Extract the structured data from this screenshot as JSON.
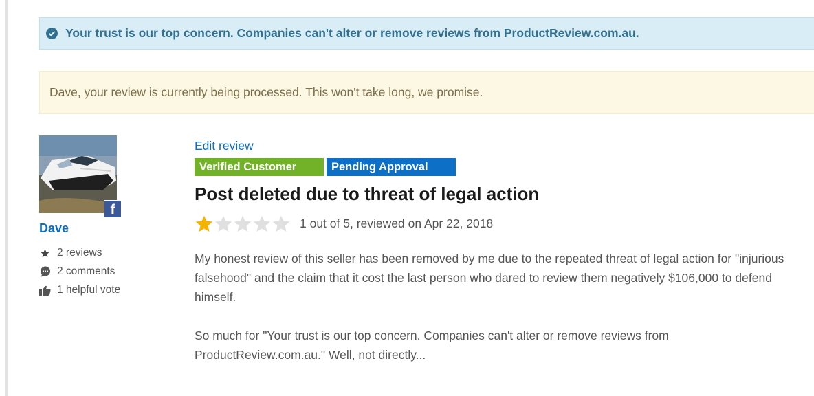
{
  "trust_banner": {
    "icon": "check-circle-icon",
    "text": "Your trust is our top concern. Companies can't alter or remove reviews from ProductReview.com.au."
  },
  "processing_banner": {
    "text": "Dave, your review is currently being processed. This won't take long, we promise."
  },
  "reviewer": {
    "name": "Dave",
    "avatar": "boat-photo",
    "social_icon": "facebook-icon",
    "social_label": "f",
    "stats": [
      {
        "icon": "star-icon",
        "label": "2 reviews"
      },
      {
        "icon": "comment-icon",
        "label": "2 comments"
      },
      {
        "icon": "thumbs-up-icon",
        "label": "1 helpful vote"
      }
    ]
  },
  "review": {
    "edit_label": "Edit review",
    "badges": {
      "verified": "Verified Customer",
      "pending": "Pending Approval"
    },
    "title": "Post deleted due to threat of legal action",
    "rating": 1,
    "rating_max": 5,
    "rating_text": "1 out of 5, reviewed on Apr 22, 2018",
    "paragraphs": [
      "My honest review of this seller has been removed by me due to the repeated threat of legal action for \"injurious falsehood\" and the claim that it cost the last person who dared to review them negatively $106,000 to defend himself.",
      "So much for \"Your trust is our top concern. Companies can't alter or remove reviews from ProductReview.com.au.\" Well, not directly..."
    ]
  },
  "colors": {
    "link": "#0d6ebf",
    "verified_badge": "#72b228",
    "pending_badge": "#0d70c6",
    "star_filled": "#f5b301",
    "star_empty": "#e0e0e0",
    "info_bg": "#d9edf7",
    "warning_bg": "#fcf8e3"
  }
}
